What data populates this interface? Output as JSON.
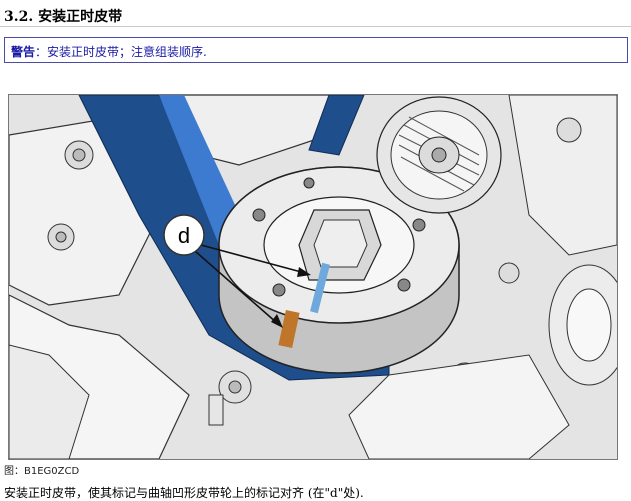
{
  "section_title": "3.2. 安装正时皮带",
  "warning": {
    "label": "警告",
    "text": "：安装正时皮带；注意组装顺序."
  },
  "figure": {
    "callout_label": "d",
    "belt_color": "#1f4e8c",
    "mark_upper_color": "#6fa8dc",
    "mark_lower_color": "#c0762a"
  },
  "caption": "图：B1EG0ZCD",
  "instruction": "安装正时皮带，使其标记与曲轴凹形皮带轮上的标记对齐 (在\"d\"处)."
}
